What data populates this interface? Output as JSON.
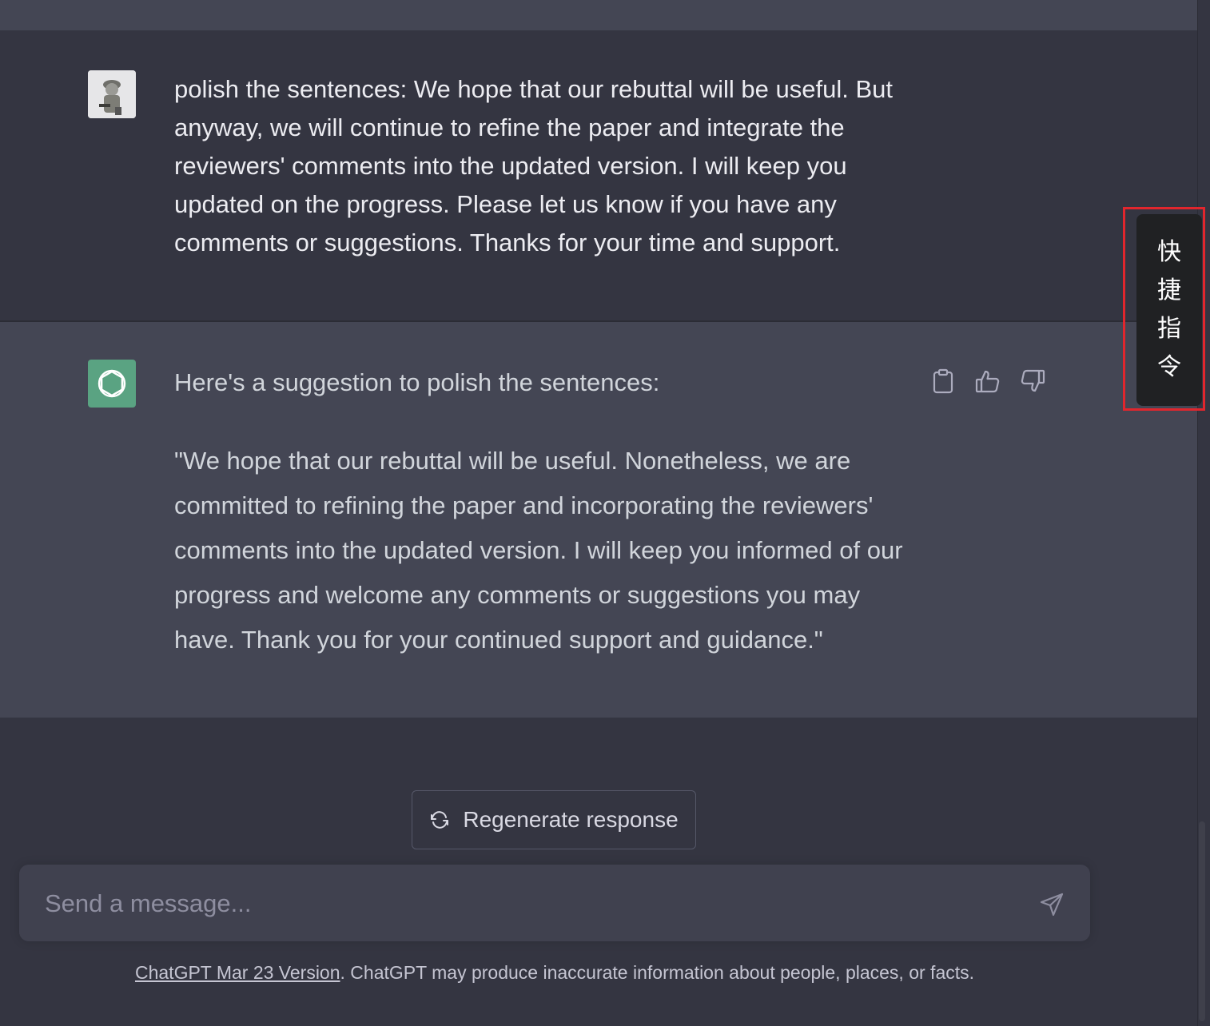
{
  "conversation": {
    "user_message": {
      "text": "polish the sentences: We hope that our rebuttal will be useful. But anyway, we will continue to refine the paper and integrate the reviewers' comments into the updated version. I will keep you updated on the progress. Please let us know if you have any comments or suggestions. Thanks for your time and support."
    },
    "assistant_message": {
      "intro": "Here's a suggestion to polish the sentences:",
      "body": "\"We hope that our rebuttal will be useful. Nonetheless, we are committed to refining the paper and incorporating the reviewers' comments into the updated version. I will keep you informed of our progress and welcome any comments or suggestions you may have. Thank you for your continued support and guidance.\"",
      "actions": {
        "copy_icon": "clipboard-icon",
        "like_icon": "thumbs-up-icon",
        "dislike_icon": "thumbs-down-icon"
      }
    }
  },
  "quick_command": {
    "label": "快捷指令",
    "chars": [
      "快",
      "捷",
      "指",
      "令"
    ]
  },
  "regenerate": {
    "label": "Regenerate response",
    "icon": "refresh-icon"
  },
  "composer": {
    "placeholder": "Send a message...",
    "value": "",
    "send_icon": "send-icon"
  },
  "footer": {
    "link_text": "ChatGPT Mar 23 Version",
    "text": ". ChatGPT may produce inaccurate information about people, places, or facts."
  },
  "colors": {
    "background": "#343541",
    "assistant_bg": "#444654",
    "gpt_brand": "#5aa382",
    "highlight_border": "#e1262d"
  }
}
